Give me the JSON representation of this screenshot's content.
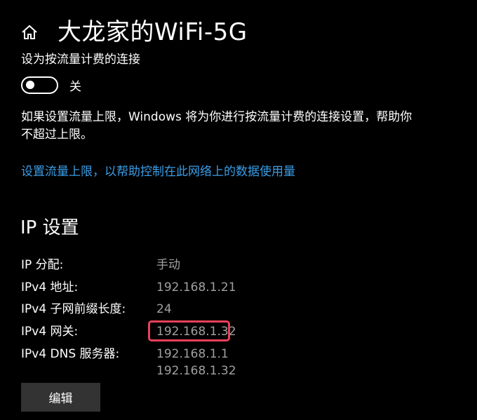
{
  "header": {
    "home_icon": "home-icon",
    "title": "大龙家的WiFi-5G"
  },
  "metered": {
    "label": "设为按流量计费的连接",
    "toggle_state": "关",
    "description": "如果设置流量上限，Windows 将为你进行按流量计费的连接设置，帮助你不超过上限。",
    "link": "设置流量上限，以帮助控制在此网络上的数据使用量"
  },
  "ip_settings": {
    "title": "IP 设置",
    "rows": [
      {
        "label": "IP 分配:",
        "value": "手动"
      },
      {
        "label": "IPv4 地址:",
        "value": "192.168.1.21"
      },
      {
        "label": "IPv4 子网前缀长度:",
        "value": "24"
      },
      {
        "label": "IPv4 网关:",
        "value": "192.168.1.32"
      },
      {
        "label": "IPv4 DNS 服务器:",
        "value": "192.168.1.1",
        "value2": "192.168.1.32"
      }
    ],
    "edit_label": "编辑"
  },
  "colors": {
    "background": "#000000",
    "link": "#3a9ee8",
    "value_text": "#a0a0a0",
    "highlight": "#e8415a",
    "button": "#333333"
  }
}
